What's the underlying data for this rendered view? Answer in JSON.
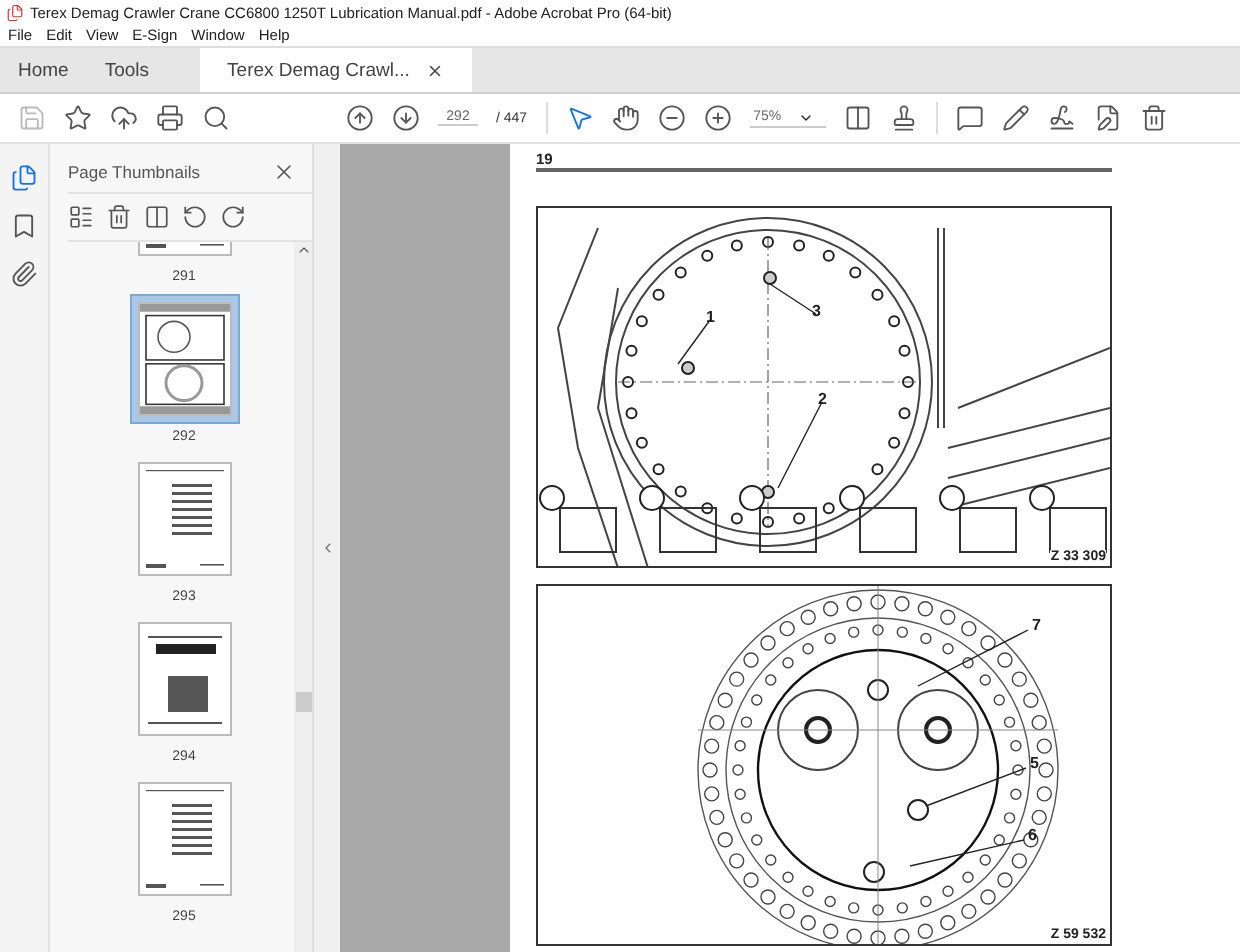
{
  "window": {
    "title": "Terex Demag Crawler Crane CC6800 1250T Lubrication Manual.pdf - Adobe Acrobat Pro (64-bit)"
  },
  "menu": [
    "File",
    "Edit",
    "View",
    "E-Sign",
    "Window",
    "Help"
  ],
  "tabs": [
    {
      "label": "Home",
      "selected": false,
      "closable": false
    },
    {
      "label": "Tools",
      "selected": false,
      "closable": false
    },
    {
      "label": "Terex Demag Crawl...",
      "selected": true,
      "closable": true
    }
  ],
  "toolbar": {
    "page_number": "292",
    "page_total": "/ 447",
    "zoom": "75%"
  },
  "panel": {
    "title": "Page Thumbnails",
    "thumbnails": [
      {
        "label": "291",
        "kind": "text",
        "selected": false
      },
      {
        "label": "292",
        "kind": "figures",
        "selected": true
      },
      {
        "label": "293",
        "kind": "text",
        "selected": false
      },
      {
        "label": "294",
        "kind": "photo",
        "selected": false
      },
      {
        "label": "295",
        "kind": "text",
        "selected": false
      }
    ]
  },
  "document": {
    "page_header": "19",
    "figures": [
      {
        "kind": "crawler",
        "caption": "Z 33 309",
        "callouts": [
          "1",
          "3",
          "2"
        ]
      },
      {
        "kind": "gearbox",
        "caption": "Z 59 532",
        "callouts": [
          "7",
          "5",
          "6"
        ]
      }
    ]
  }
}
